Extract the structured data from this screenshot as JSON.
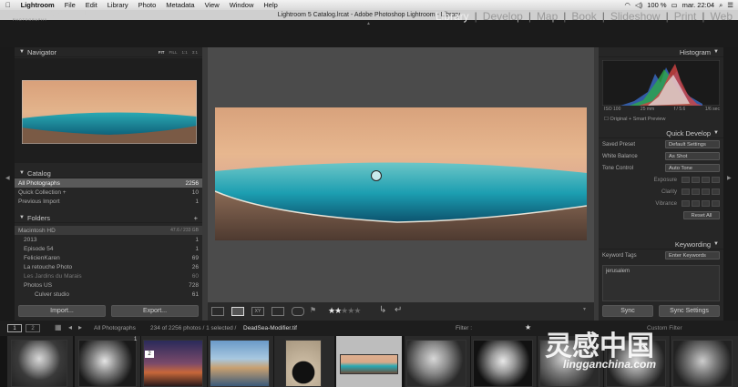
{
  "menubar": {
    "apple": "",
    "app": "Lightroom",
    "items": [
      "File",
      "Edit",
      "Library",
      "Photo",
      "Metadata",
      "View",
      "Window",
      "Help"
    ],
    "status": "100 %",
    "clock": "mar. 22:04"
  },
  "window": {
    "title": "Lightroom 5 Catalog.lrcat - Adobe Photoshop Lightroom - Library"
  },
  "brand": {
    "name": "SERGE RAMELLI",
    "sub": "PHOTOGRAPHY"
  },
  "modules": [
    "Library",
    "Develop",
    "Map",
    "Book",
    "Slideshow",
    "Print",
    "Web"
  ],
  "navigator": {
    "title": "Navigator",
    "zoom_opts": [
      "FIT",
      "FILL",
      "1:1",
      "3:1"
    ]
  },
  "catalog": {
    "title": "Catalog",
    "items": [
      {
        "label": "All Photographs",
        "count": "2256"
      },
      {
        "label": "Quick Collection +",
        "count": "10"
      },
      {
        "label": "Previous Import",
        "count": "1"
      }
    ]
  },
  "folders": {
    "title": "Folders",
    "drive": {
      "label": "Macintosh HD",
      "space": "47.6 / 233 GB"
    },
    "items": [
      {
        "label": "2013",
        "count": "1"
      },
      {
        "label": "Episode 54",
        "count": "1"
      },
      {
        "label": "FelicienKaren",
        "count": "69"
      },
      {
        "label": "La retouche Photo",
        "count": "26"
      },
      {
        "label": "Les Jardins du Marais",
        "count": "60"
      },
      {
        "label": "Photos US",
        "count": "728"
      },
      {
        "label": "Culver studio",
        "count": "61"
      }
    ]
  },
  "left_buttons": {
    "import": "Import...",
    "export": "Export..."
  },
  "histogram": {
    "title": "Histogram",
    "iso": "ISO 100",
    "focal": "25 mm",
    "aperture": "f / 5.6",
    "shutter": "1/6 sec",
    "status": "Original + Smart Preview"
  },
  "quick_develop": {
    "title": "Quick Develop",
    "saved_preset_label": "Saved Preset",
    "saved_preset_value": "Default Settings",
    "white_balance_label": "White Balance",
    "white_balance_value": "As Shot",
    "tone_control_label": "Tone Control",
    "tone_control_value": "Auto Tone",
    "exposure": "Exposure",
    "clarity": "Clarity",
    "vibrance": "Vibrance",
    "reset": "Reset All"
  },
  "keywording": {
    "title": "Keywording",
    "tags_label": "Keyword Tags",
    "tags_value": "Enter Keywords",
    "keyword": "jerusalem"
  },
  "right_buttons": {
    "sync": "Sync",
    "sync_settings": "Sync Settings"
  },
  "filmstrip_bar": {
    "page1": "1",
    "page2": "2",
    "source": "All Photographs",
    "info": "234 of 2256 photos / 1 selected /",
    "filename": "DeadSea-Modifier.tif",
    "filter_label": "Filter :",
    "filter_value": "Custom Filter"
  },
  "thumb_badges": [
    "1",
    "2"
  ],
  "rating": {
    "stars": 2,
    "max": 5
  },
  "watermark": {
    "cn": "灵感中国",
    "url": "lingganchina.com"
  },
  "colors": {
    "accent": "#efefef",
    "panel": "#262626",
    "bg": "#3a3a3a"
  }
}
